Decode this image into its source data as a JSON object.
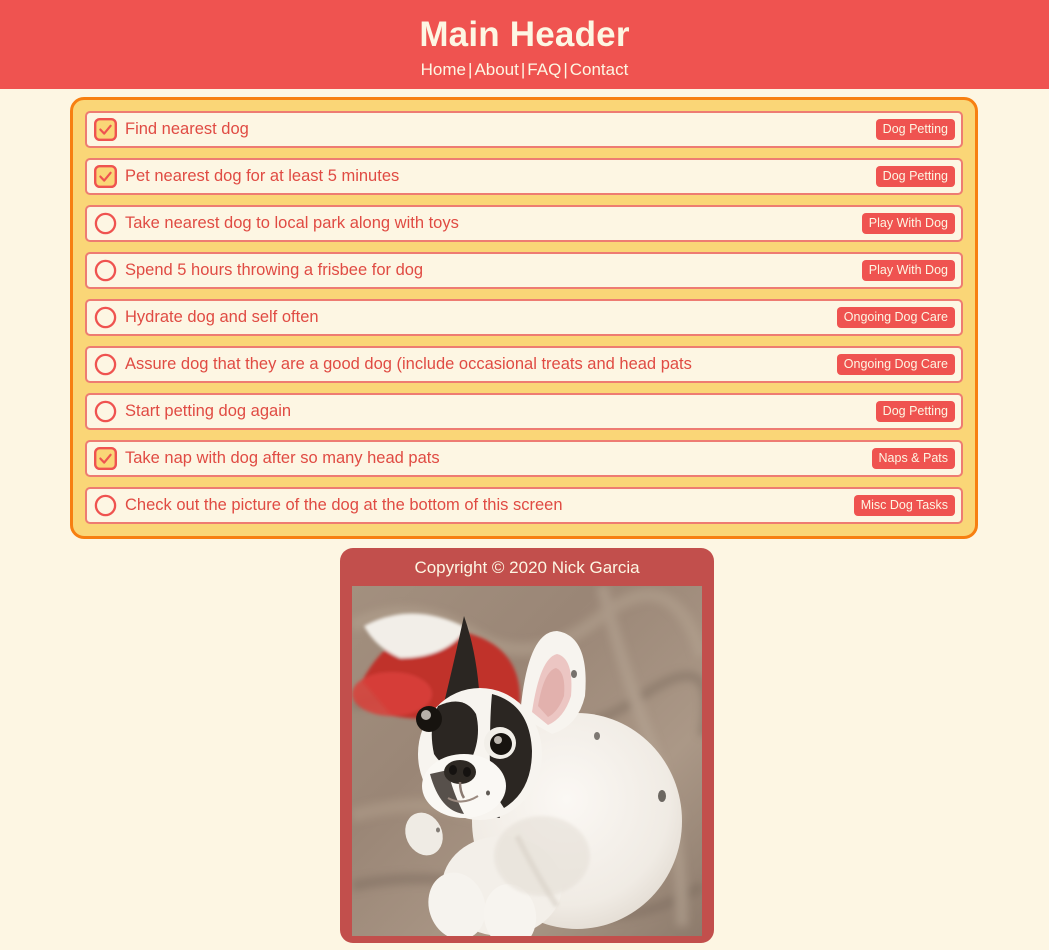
{
  "header": {
    "title": "Main Header",
    "nav": [
      {
        "label": "Home"
      },
      {
        "label": "About"
      },
      {
        "label": "FAQ"
      },
      {
        "label": "Contact"
      }
    ],
    "separator": "|"
  },
  "colors": {
    "header_red": "#ef5350",
    "page_bg": "#fdf6e3",
    "container_bg": "#fad677",
    "container_border": "#f77f11",
    "row_bg": "#fdf6e3",
    "row_border": "#ee7c72",
    "text_red": "#e04b43",
    "badge_bg": "#ef5350",
    "badge_text": "#fdf6e3",
    "footer_bg": "#c24f4c",
    "checkbox_fill": "#fad677"
  },
  "todo_list": {
    "items": [
      {
        "text": "Find nearest dog",
        "badge": "Dog Petting",
        "checked": true
      },
      {
        "text": "Pet nearest dog for at least 5 minutes",
        "badge": "Dog Petting",
        "checked": true
      },
      {
        "text": "Take nearest dog to local park along with toys",
        "badge": "Play With Dog",
        "checked": false
      },
      {
        "text": "Spend 5 hours throwing a frisbee for dog",
        "badge": "Play With Dog",
        "checked": false
      },
      {
        "text": "Hydrate dog and self often",
        "badge": "Ongoing Dog Care",
        "checked": false
      },
      {
        "text": "Assure dog that they are a good dog (include occasional treats and head pats",
        "badge": "Ongoing Dog Care",
        "checked": false
      },
      {
        "text": "Start petting dog again",
        "badge": "Dog Petting",
        "checked": false
      },
      {
        "text": "Take nap with dog after so many head pats",
        "badge": "Naps & Pats",
        "checked": true
      },
      {
        "text": "Check out the picture of the dog at the bottom of this screen",
        "badge": "Misc Dog Tasks",
        "checked": false
      }
    ]
  },
  "footer": {
    "copyright": "Copyright © 2020 Nick Garcia",
    "image_alt": "french-bulldog-puppy-photo"
  }
}
